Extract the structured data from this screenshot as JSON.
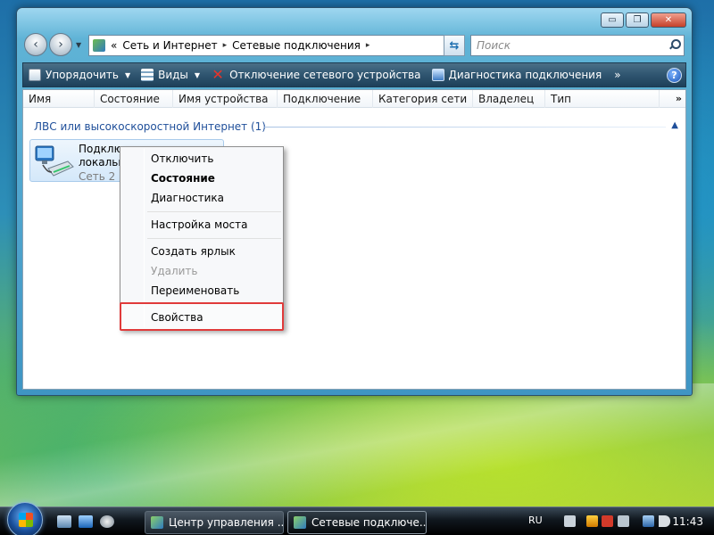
{
  "window": {
    "controls": {
      "minimize": "▭",
      "maximize": "❐",
      "close": "✕"
    }
  },
  "nav": {
    "back": "‹",
    "forward": "›",
    "breadcrumb_prefix": "«",
    "crumbs": [
      "Сеть и Интернет",
      "Сетевые подключения"
    ],
    "crumb_sep": "▸",
    "search_placeholder": "Поиск"
  },
  "toolbar": {
    "organize": "Упорядочить",
    "views": "Виды",
    "disable": "Отключение сетевого устройства",
    "diagnose": "Диагностика подключения",
    "more": "»",
    "help": "?"
  },
  "columns": [
    "Имя",
    "Состояние",
    "Имя устройства",
    "Подключение",
    "Категория сети",
    "Владелец",
    "Тип"
  ],
  "columns_more": "»",
  "group": {
    "title": "ЛВС или высокоскоростной Интернет (1)",
    "toggle": "▲"
  },
  "connection": {
    "name": "Подключение по локальной сети",
    "network": "Сеть  2"
  },
  "context_menu": {
    "items": [
      "Отключить",
      "Состояние",
      "Диагностика",
      "Настройка моста",
      "Создать ярлык",
      "Удалить",
      "Переименовать",
      "Свойства"
    ]
  },
  "taskbar": {
    "buttons": [
      "Центр управления ...",
      "Сетевые подключе..."
    ],
    "lang": "RU",
    "clock": "11:43"
  },
  "colors": {
    "highlight_border": "#e03a3a",
    "group_text": "#1f4f9a"
  }
}
